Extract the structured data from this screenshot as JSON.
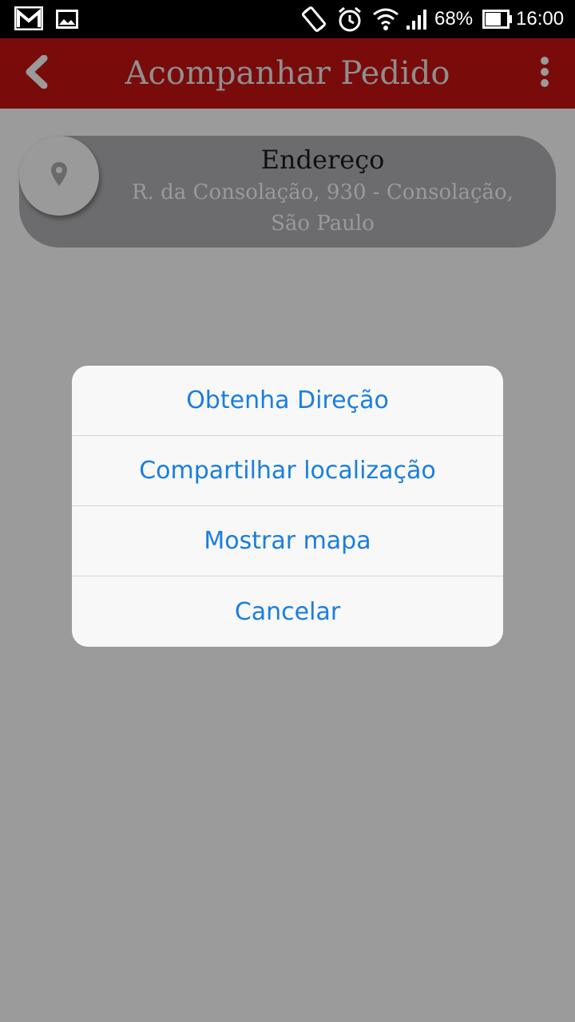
{
  "status_bar": {
    "battery": "68%",
    "time": "16:00",
    "icons": [
      "gmail-icon",
      "image-icon",
      "auto-rotate-icon",
      "alarm-icon",
      "wifi-icon",
      "signal-icon",
      "battery-icon"
    ]
  },
  "app_bar": {
    "title": "Acompanhar Pedido",
    "back_icon": "chevron-left-icon",
    "menu_icon": "more-vertical-icon"
  },
  "address": {
    "title": "Endereço",
    "line1": "R. da Consolação, 930 - Consolação,",
    "line2": "São Paulo",
    "icon": "location-pin-icon"
  },
  "action_sheet": {
    "options": [
      {
        "label": "Obtenha Direção"
      },
      {
        "label": "Compartilhar localização"
      },
      {
        "label": "Mostrar mapa"
      },
      {
        "label": "Cancelar"
      }
    ]
  },
  "colors": {
    "app_bar": "#7a0b0b",
    "overlay_background": "#9b9b9b",
    "action_text": "#1a7ee0",
    "card_background": "#6c6c6e"
  }
}
